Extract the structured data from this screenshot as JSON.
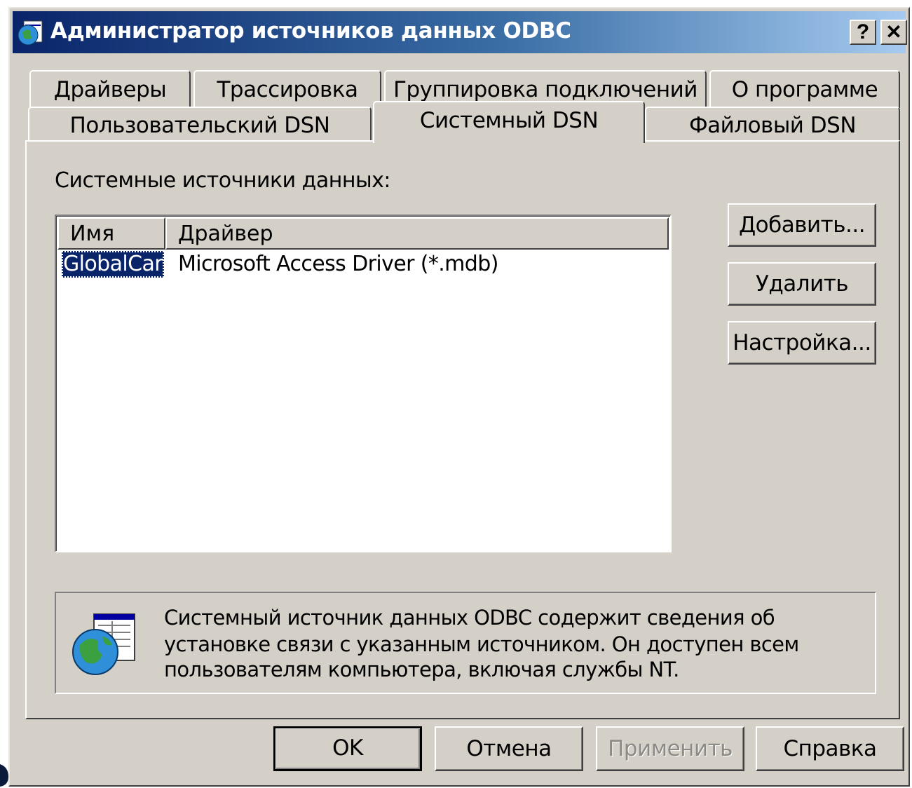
{
  "window": {
    "title": "Администратор источников данных ODBC",
    "help_button": "?",
    "close_button": "✕"
  },
  "tabs": {
    "back_row": [
      "Драйверы",
      "Трассировка",
      "Группировка подключений",
      "О программе"
    ],
    "front_row": [
      "Пользовательский DSN",
      "Системный DSN",
      "Файловый DSN"
    ],
    "active": "Системный DSN"
  },
  "dsn_list": {
    "label": "Системные источники данных:",
    "columns": [
      "Имя",
      "Драйвер"
    ],
    "rows": [
      {
        "name": "GlobalCar",
        "driver": "Microsoft Access Driver (*.mdb)",
        "selected": true
      }
    ]
  },
  "side_buttons": {
    "add": "Добавить...",
    "remove": "Удалить",
    "configure": "Настройка..."
  },
  "info": {
    "lines": [
      "Системный источник данных ODBC содержит сведения об",
      "установке связи с указанным источником. Он доступен всем",
      "пользователям компьютера, включая службы NT."
    ]
  },
  "footer_buttons": {
    "ok": "OK",
    "cancel": "Отмена",
    "apply": "Применить",
    "help": "Справка"
  },
  "colors": {
    "title_gradient_start": "#0a246a",
    "title_gradient_end": "#a6caf0",
    "dialog_face": "#d4d0c8",
    "selection": "#0a246a"
  }
}
